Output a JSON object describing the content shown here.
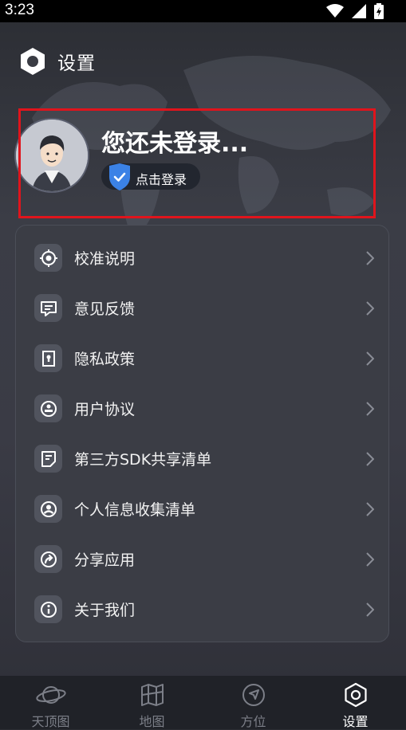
{
  "status_bar": {
    "time": "3:23"
  },
  "header": {
    "title": "设置"
  },
  "profile": {
    "title": "您还未登录...",
    "login_button": "点击登录"
  },
  "menu": {
    "items": [
      {
        "label": "校准说明",
        "icon": "calibration-icon"
      },
      {
        "label": "意见反馈",
        "icon": "feedback-icon"
      },
      {
        "label": "隐私政策",
        "icon": "privacy-lock-icon"
      },
      {
        "label": "用户协议",
        "icon": "user-agreement-stamp-icon"
      },
      {
        "label": "第三方SDK共享清单",
        "icon": "sdk-list-icon"
      },
      {
        "label": "个人信息收集清单",
        "icon": "personal-info-icon"
      },
      {
        "label": "分享应用",
        "icon": "share-icon"
      },
      {
        "label": "关于我们",
        "icon": "info-icon"
      }
    ]
  },
  "tabbar": {
    "tabs": [
      {
        "label": "天顶图",
        "icon": "planet-icon"
      },
      {
        "label": "地图",
        "icon": "map-icon"
      },
      {
        "label": "方位",
        "icon": "compass-arrow-icon"
      },
      {
        "label": "设置",
        "icon": "settings-hexagon-icon",
        "active": true
      }
    ]
  },
  "colors": {
    "highlight": "#e0141c",
    "shield": "#3b82e6",
    "active_tab": "#ffffff",
    "inactive_tab": "#7c7f88"
  }
}
